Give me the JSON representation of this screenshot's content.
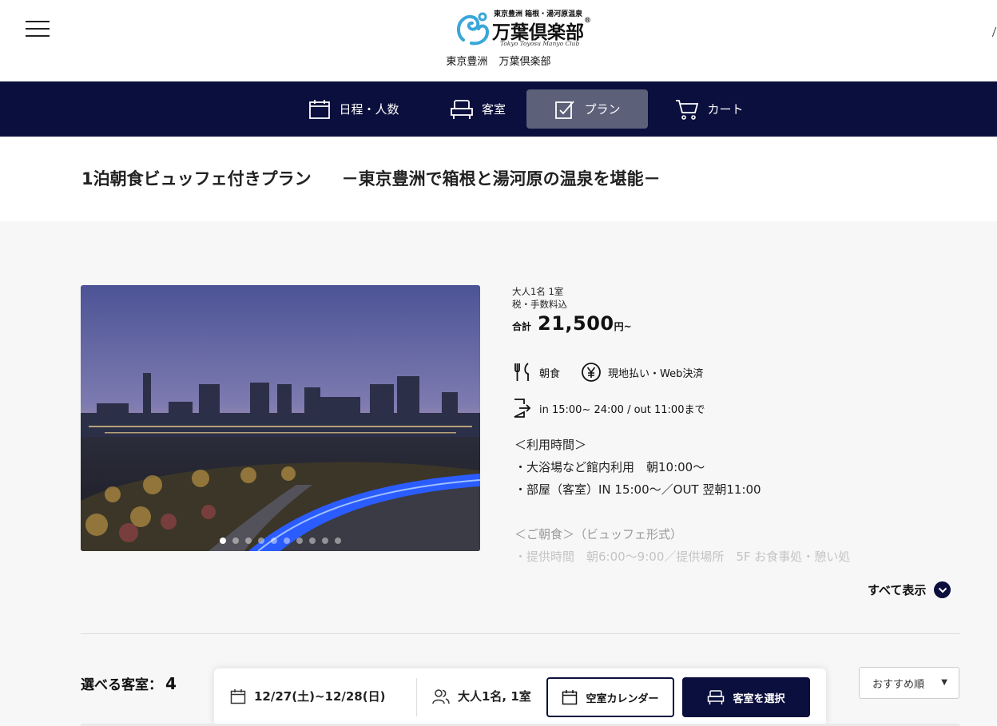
{
  "header": {
    "logo_small": "東京豊洲 箱根・湯河原温泉",
    "logo_main": "万葉倶楽部",
    "logo_reg": "®",
    "logo_en": "Tokyo Toyosu Manyo Club",
    "site_name": "東京豊洲 万葉倶楽部"
  },
  "nav": {
    "items": [
      {
        "label": "日程・人数",
        "icon": "calendar-icon"
      },
      {
        "label": "客室",
        "icon": "bed-icon"
      },
      {
        "label": "プラン",
        "icon": "plan-check-icon"
      },
      {
        "label": "カート",
        "icon": "cart-icon"
      }
    ],
    "active_index": 2
  },
  "plan": {
    "title": "1泊朝食ビュッフェ付きプラン",
    "subtitle": "－東京豊洲で箱根と湯河原の温泉を堪能－",
    "occupancy": "大人1名 1室",
    "tax_note": "税・手数料込",
    "price_label": "合計",
    "price_value": "21,500",
    "price_unit": "円~",
    "meal": "朝食",
    "payment": "現地払い・Web決済",
    "checkin_time": "in 15:00~ 24:00 / out 11:00まで",
    "description": [
      "＜利用時間＞",
      "・大浴場など館内利用　朝10:00～",
      "・部屋（客室）IN 15:00～／OUT 翌朝11:00",
      "＜ご朝食＞（ビュッフェ形式）",
      "・提供時間　朝6:00～9:00／提供場所　5F お食事処・憩い処"
    ],
    "show_all_label": "すべて表示"
  },
  "slider": {
    "dot_count": 10,
    "active_index": 0
  },
  "rooms": {
    "label": "選べる客室：",
    "count": "4",
    "sort_label": "おすすめ順"
  },
  "booking_bar": {
    "dates": "12/27(土)~12/28(日)",
    "guests": "大人1名, 1室",
    "calendar_label": "空室カレンダー",
    "select_room_label": "客室を選択"
  },
  "colors": {
    "navy": "#0b0f3d",
    "nav_active": "#5c6079",
    "logo_blue": "#3aa6d9"
  }
}
